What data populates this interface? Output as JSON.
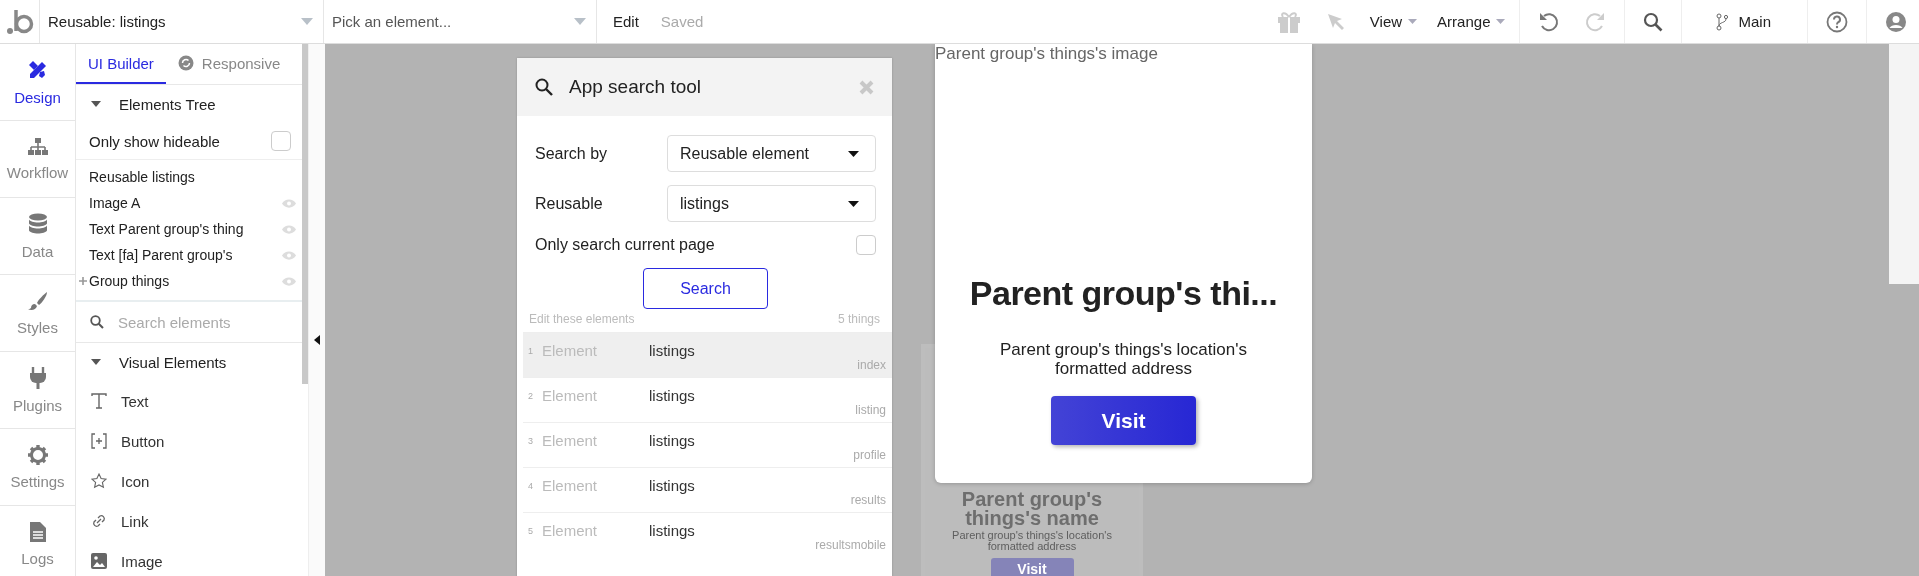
{
  "toolbar": {
    "page_dropdown": "Reusable: listings",
    "element_dropdown": "Pick an element...",
    "edit": "Edit",
    "saved": "Saved",
    "view": "View",
    "arrange": "Arrange",
    "branch": "Main"
  },
  "nav": [
    {
      "label": "Design",
      "kind": "design",
      "selected": true
    },
    {
      "label": "Workflow",
      "kind": "workflow",
      "selected": false
    },
    {
      "label": "Data",
      "kind": "data",
      "selected": false
    },
    {
      "label": "Styles",
      "kind": "styles",
      "selected": false
    },
    {
      "label": "Plugins",
      "kind": "plugins",
      "selected": false
    },
    {
      "label": "Settings",
      "kind": "settings",
      "selected": false
    },
    {
      "label": "Logs",
      "kind": "logs",
      "selected": false
    }
  ],
  "panel": {
    "tabs": [
      {
        "label": "UI Builder",
        "selected": true
      },
      {
        "label": "Responsive",
        "selected": false
      }
    ],
    "tree_header": "Elements Tree",
    "only_hideable": {
      "label": "Only show hideable",
      "checked": false
    },
    "tree": [
      {
        "label": "Reusable listings",
        "kind": "root"
      },
      {
        "label": "Image A",
        "kind": "element"
      },
      {
        "label": "Text Parent group's thing",
        "kind": "element"
      },
      {
        "label": "Text [fa] Parent group's",
        "kind": "element"
      },
      {
        "label": "Group things",
        "kind": "group"
      }
    ],
    "search_placeholder": "Search elements",
    "visual_header": "Visual Elements",
    "elements": [
      {
        "label": "Text",
        "kind": "text"
      },
      {
        "label": "Button",
        "kind": "button"
      },
      {
        "label": "Icon",
        "kind": "icon"
      },
      {
        "label": "Link",
        "kind": "link"
      },
      {
        "label": "Image",
        "kind": "image"
      }
    ]
  },
  "search_tool": {
    "title": "App search tool",
    "fields": [
      {
        "label": "Search by",
        "value": "Reusable element"
      },
      {
        "label": "Reusable",
        "value": "listings"
      }
    ],
    "current_page": {
      "label": "Only search current page",
      "checked": false
    },
    "button": "Search",
    "results_label": "Edit these elements",
    "count": "5 things",
    "results": [
      {
        "index": "1",
        "type": "Element",
        "name": "listings",
        "page": "index",
        "selected": true
      },
      {
        "index": "2",
        "type": "Element",
        "name": "listings",
        "page": "listing",
        "selected": false
      },
      {
        "index": "3",
        "type": "Element",
        "name": "listings",
        "page": "profile",
        "selected": false
      },
      {
        "index": "4",
        "type": "Element",
        "name": "listings",
        "page": "results",
        "selected": false
      },
      {
        "index": "5",
        "type": "Element",
        "name": "listings",
        "page": "resultsmobile",
        "selected": false
      }
    ]
  },
  "canvas": {
    "card": {
      "image_label": "Parent group's things's image",
      "title": "Parent group's thi...",
      "address": "Parent group's things's location's formatted address",
      "button": "Visit"
    },
    "ghost_card": {
      "title": "Parent group's things's name",
      "address": "Parent group's things's location's formatted address",
      "button": "Visit"
    }
  }
}
